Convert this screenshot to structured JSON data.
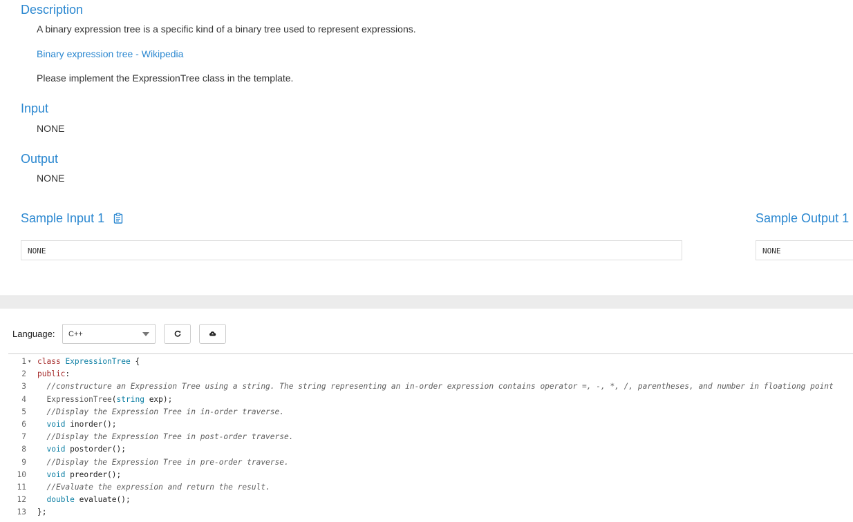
{
  "description": {
    "heading": "Description",
    "text": "A binary expression tree is a specific kind of a binary tree used to represent expressions.",
    "link": "Binary expression tree - Wikipedia",
    "instruction": "Please implement the ExpressionTree class in the template."
  },
  "input": {
    "heading": "Input",
    "text": "NONE"
  },
  "output": {
    "heading": "Output",
    "text": "NONE"
  },
  "sample_input": {
    "heading": "Sample Input 1",
    "value": "NONE",
    "icon": "clipboard-icon"
  },
  "sample_output": {
    "heading": "Sample Output 1",
    "value": "NONE"
  },
  "editor": {
    "language_label": "Language:",
    "language_value": "C++",
    "reset_icon": "refresh-icon",
    "upload_icon": "cloud-upload-icon",
    "lines": [
      {
        "n": "1",
        "code": "class ExpressionTree {"
      },
      {
        "n": "2",
        "code": "public:"
      },
      {
        "n": "3",
        "code": "  //constructure an Expression Tree using a string. The string representing an in-order expression contains operator =, -, *, /, parentheses, and number in floationg point"
      },
      {
        "n": "4",
        "code": "  ExpressionTree(string exp);"
      },
      {
        "n": "5",
        "code": "  //Display the Expression Tree in in-order traverse."
      },
      {
        "n": "6",
        "code": "  void inorder();"
      },
      {
        "n": "7",
        "code": "  //Display the Expression Tree in post-order traverse."
      },
      {
        "n": "8",
        "code": "  void postorder();"
      },
      {
        "n": "9",
        "code": "  //Display the Expression Tree in pre-order traverse."
      },
      {
        "n": "10",
        "code": "  void preorder();"
      },
      {
        "n": "11",
        "code": "  //Evaluate the expression and return the result."
      },
      {
        "n": "12",
        "code": "  double evaluate();"
      },
      {
        "n": "13",
        "code": "};"
      }
    ]
  }
}
